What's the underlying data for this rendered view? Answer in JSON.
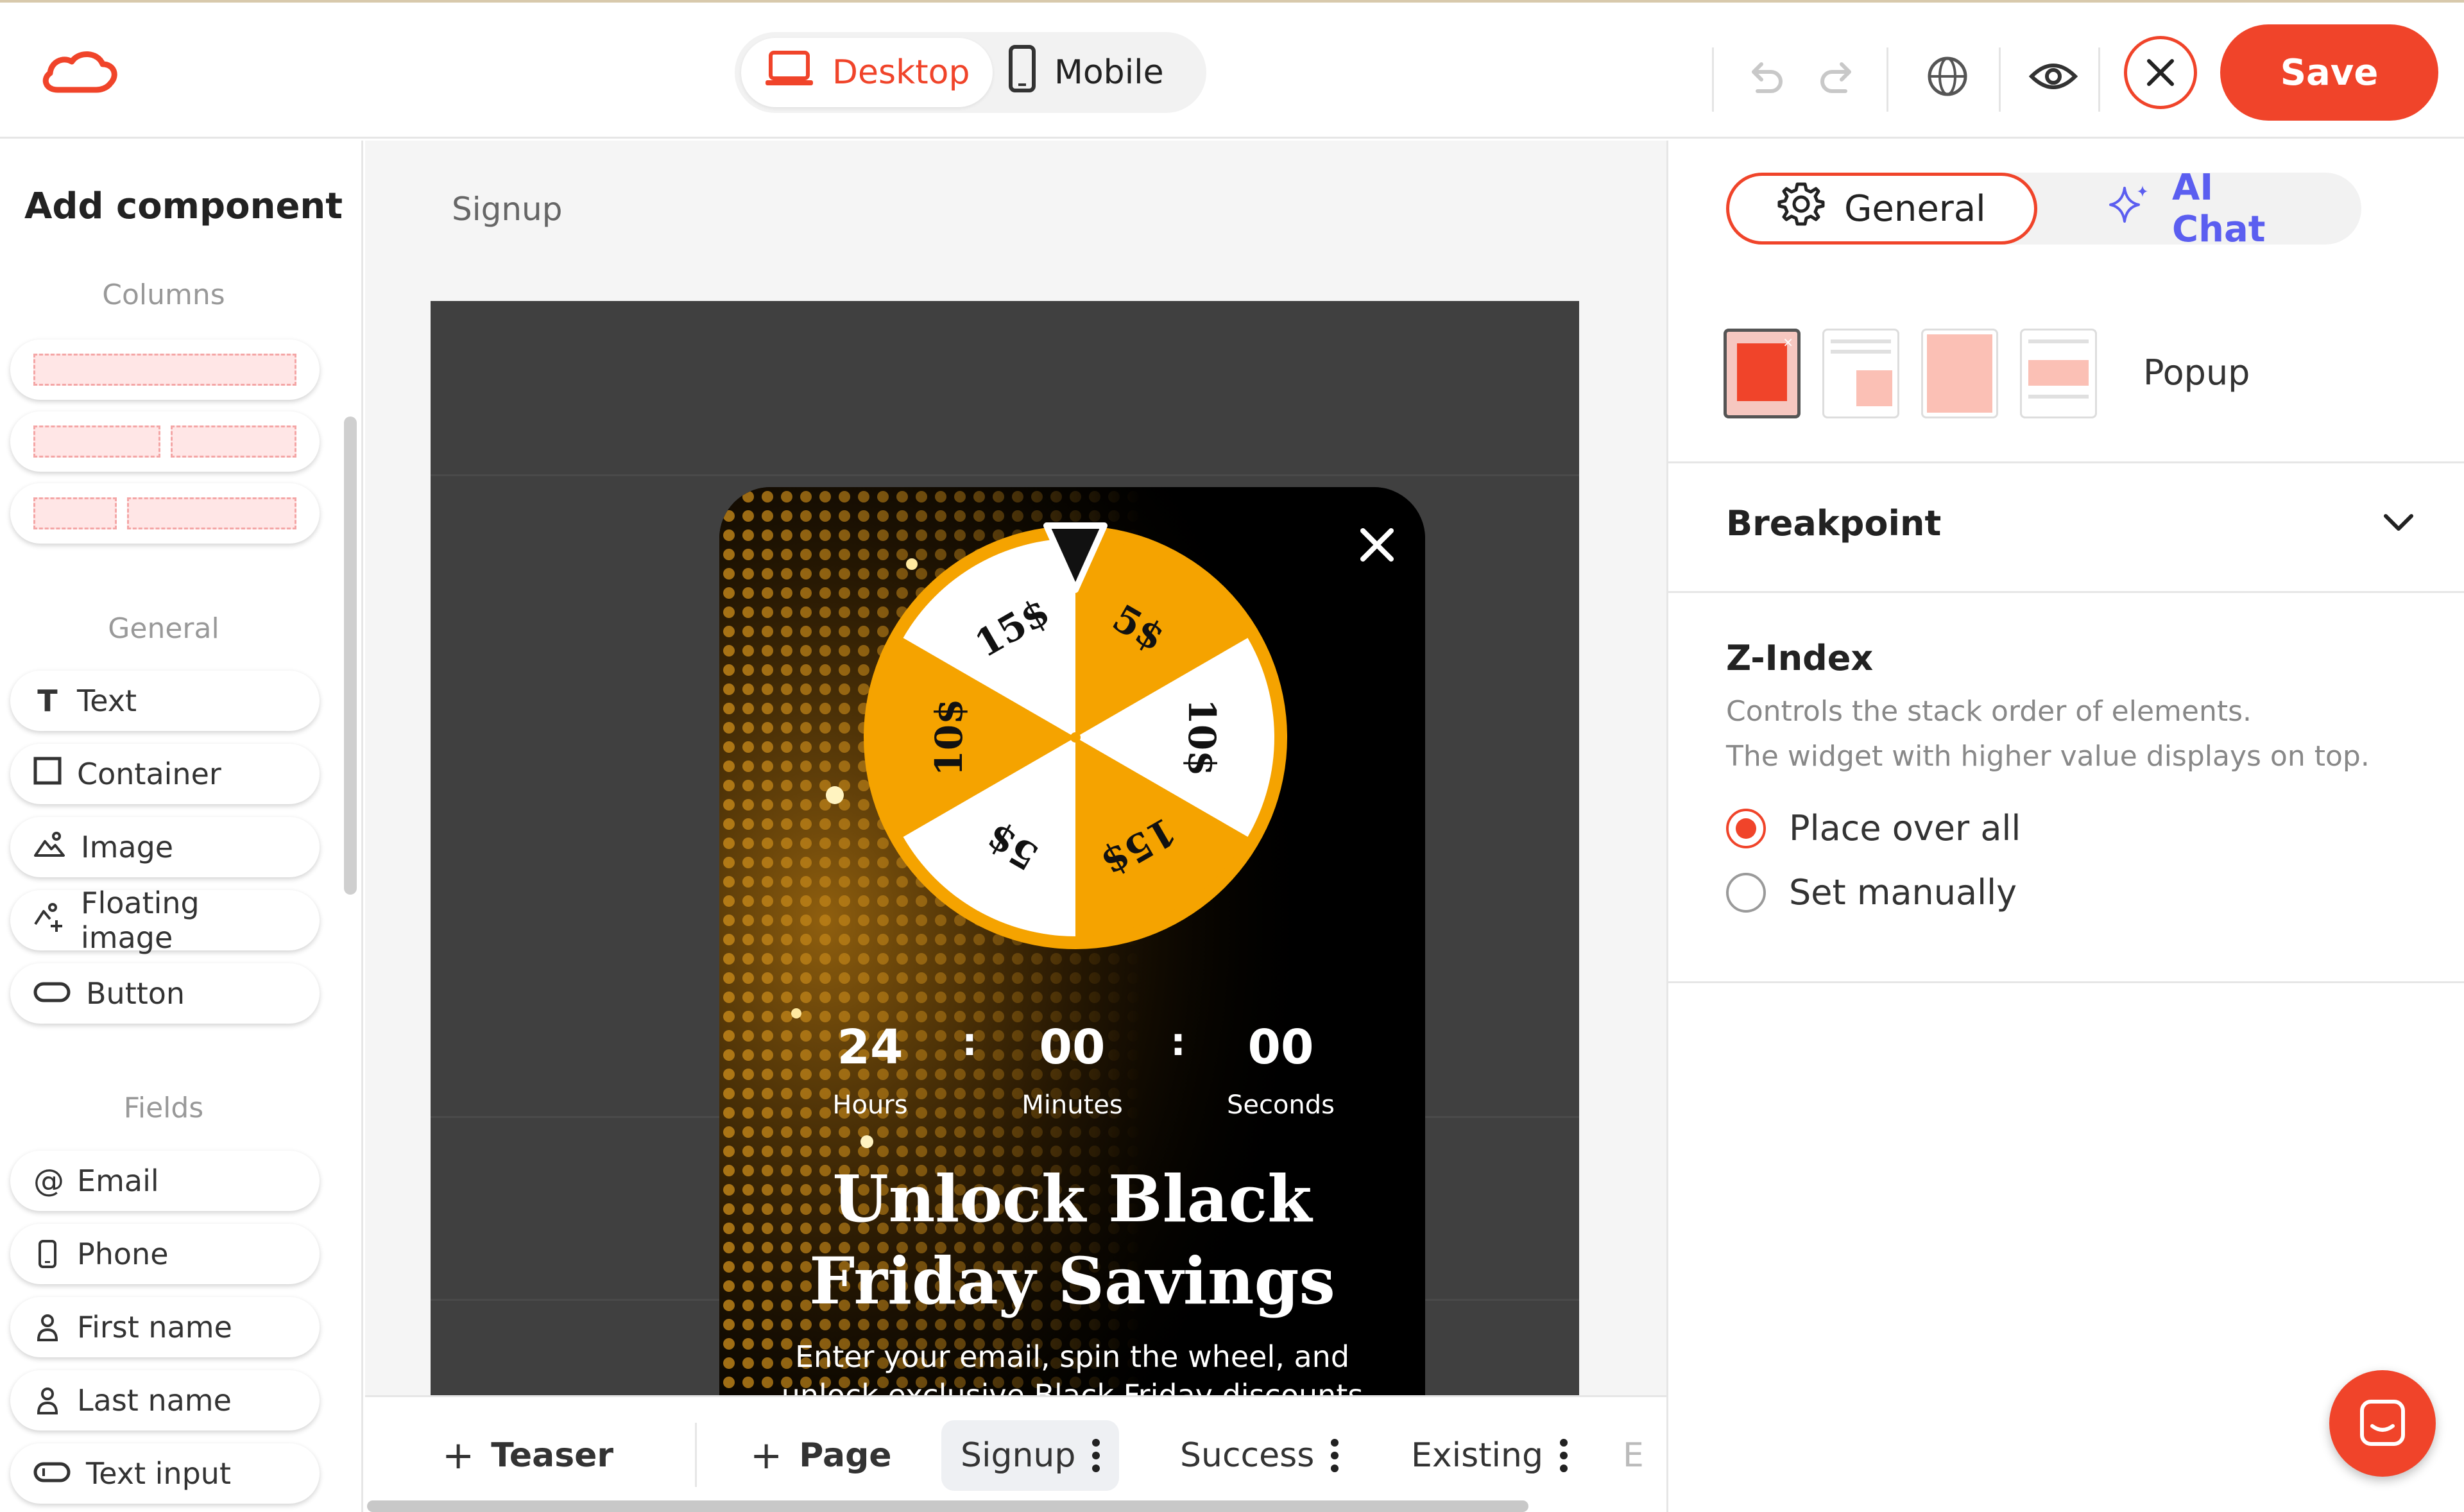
{
  "header": {
    "device_desktop": "Desktop",
    "device_mobile": "Mobile",
    "save_label": "Save"
  },
  "left_panel": {
    "title": "Add component",
    "sections": {
      "columns": "Columns",
      "general": "General",
      "fields": "Fields"
    },
    "general_items": [
      {
        "label": "Text",
        "icon": "text-icon"
      },
      {
        "label": "Container",
        "icon": "container-icon"
      },
      {
        "label": "Image",
        "icon": "image-icon"
      },
      {
        "label": "Floating image",
        "icon": "floating-image-icon"
      },
      {
        "label": "Button",
        "icon": "button-icon"
      }
    ],
    "field_items": [
      {
        "label": "Email",
        "icon": "at-icon"
      },
      {
        "label": "Phone",
        "icon": "phone-icon"
      },
      {
        "label": "First name",
        "icon": "person-icon"
      },
      {
        "label": "Last name",
        "icon": "person-icon"
      },
      {
        "label": "Text input",
        "icon": "input-icon"
      }
    ]
  },
  "canvas": {
    "breadcrumb": "Signup",
    "popup": {
      "wheel_segments": [
        "5$",
        "10$",
        "15$",
        "5$",
        "10$",
        "15$"
      ],
      "countdown": [
        {
          "value": "24",
          "label": "Hours"
        },
        {
          "value": "00",
          "label": "Minutes"
        },
        {
          "value": "00",
          "label": "Seconds"
        }
      ],
      "separator": ":",
      "headline_line1": "Unlock Black",
      "headline_line2": "Friday Savings",
      "body_line1": "Enter your email, spin the wheel, and",
      "body_line2": "unlock exclusive Black Friday discounts",
      "accent_color": "#f5a300"
    }
  },
  "bottom_tabs": {
    "add_teaser": "Teaser",
    "add_page": "Page",
    "pages": [
      "Signup",
      "Success",
      "Existing"
    ],
    "overflow": "E",
    "selected": "Signup"
  },
  "right_panel": {
    "tabs": {
      "general": "General",
      "ai_chat": "AI Chat"
    },
    "layout_label": "Popup",
    "breakpoint_title": "Breakpoint",
    "zindex": {
      "title": "Z-Index",
      "desc_line1": "Controls the stack order of elements.",
      "desc_line2": "The widget with higher value displays on top.",
      "options": [
        "Place over all",
        "Set manually"
      ],
      "selected": "Place over all"
    }
  },
  "colors": {
    "brand": "#f0442a",
    "ai_accent": "#5b5ef0"
  }
}
